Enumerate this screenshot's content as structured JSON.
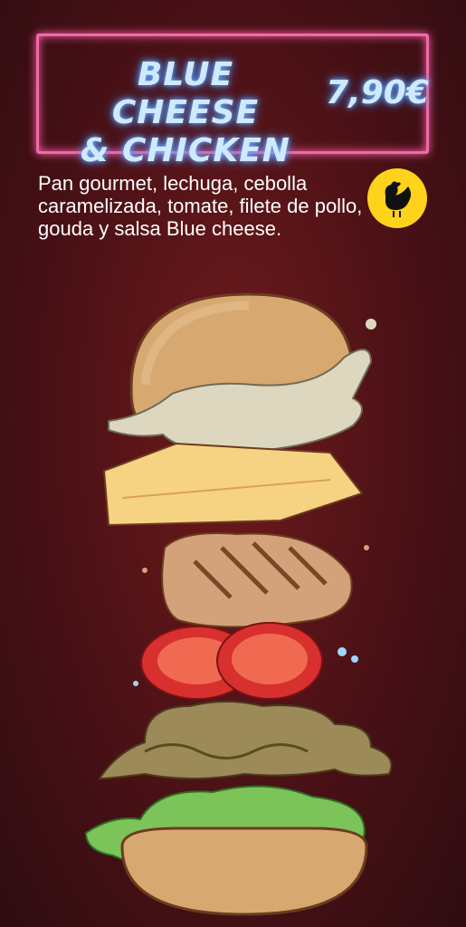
{
  "menu_item": {
    "title": "BLUE CHEESE\n& CHICKEN",
    "price": "7,90€",
    "description": "Pan gourmet, lechuga, cebolla caramelizada, tomate, filete de pollo, gouda y salsa Blue cheese."
  },
  "badge": {
    "icon": "chicken-icon"
  },
  "colors": {
    "neon_frame": "#f06aa8",
    "neon_text": "#cfe9ff",
    "badge": "#ffd21c"
  }
}
